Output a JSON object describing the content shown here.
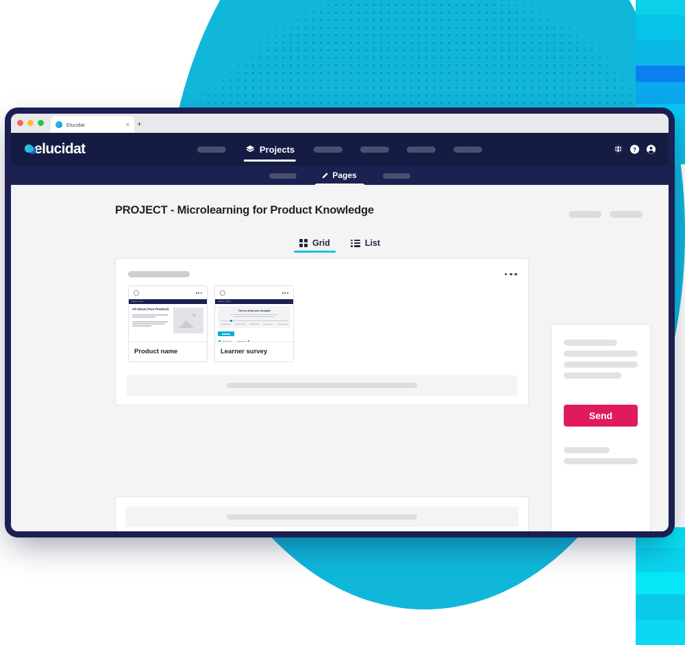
{
  "browser": {
    "tab_title": "Elucidat",
    "tab_close": "×",
    "new_tab": "+",
    "favicon_name": "elucidat-favicon"
  },
  "app": {
    "logo_text": "elucidat",
    "main_nav": {
      "active_label": "Projects",
      "active_icon": "layers-icon",
      "placeholder_items": [
        "",
        "",
        "",
        "",
        ""
      ]
    },
    "header_icons": [
      {
        "name": "globe-icon"
      },
      {
        "name": "help-icon"
      },
      {
        "name": "account-icon"
      }
    ],
    "sub_nav": {
      "active_label": "Pages",
      "active_icon": "pencil-icon",
      "placeholder_items": [
        "",
        ""
      ]
    }
  },
  "main": {
    "page_title": "PROJECT - Microlearning for Product Knowledge",
    "view_tabs": [
      {
        "label": "Grid",
        "icon": "grid-icon",
        "active": true
      },
      {
        "label": "List",
        "icon": "list-icon",
        "active": false
      }
    ],
    "card": {
      "menu_icon": "kebab-menu-icon",
      "pages": [
        {
          "label": "Product name",
          "select_icon": "radio-unchecked-icon",
          "menu_icon": "kebab-menu-icon",
          "preview": {
            "bar_text": "Product name",
            "heading": "All about [Your Product]",
            "image_placeholder": "image-placeholder-icon"
          }
        },
        {
          "label": "Learner survey",
          "select_icon": "radio-unchecked-icon",
          "menu_icon": "kebab-menu-icon",
          "preview": {
            "bar_text": "Learner survey",
            "heading": "Tell us what you thought"
          }
        }
      ]
    }
  },
  "right_panel": {
    "send_label": "Send",
    "send_color": "#E01B5D"
  },
  "colors": {
    "nav_dark": "#161B43",
    "subnav_dark": "#1B2150",
    "accent_cyan": "#18C0DF",
    "accent_pink": "#E01B5D",
    "page_bg": "#F4F4F5",
    "deco_cyan": "#10B7DB",
    "deco_dot": "#1E8FB0"
  }
}
